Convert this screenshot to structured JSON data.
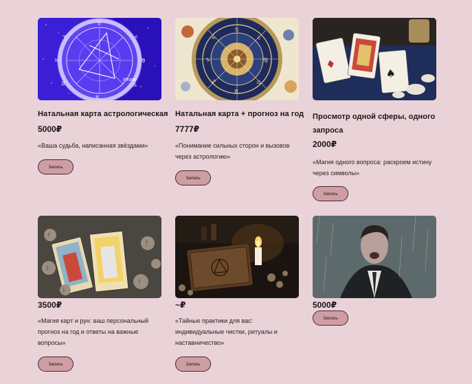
{
  "products": [
    {
      "title": "Натальная карта астрологическая",
      "price": "5000₽",
      "description": "«Ваша судьба, написанная звёздами»",
      "button": "Запись",
      "image_overlay_text": "Итоги"
    },
    {
      "title": "Натальная карта + прогноз на год",
      "price": "7777₽",
      "description": "«Понимание сильных сторон и вызовов через астрологию»",
      "button": "Запись"
    },
    {
      "title": "Просмотр одной сферы, одного запроса",
      "price": "2000₽",
      "description": "«Магия одного вопроса: раскроем истину через символы»",
      "button": "Запись"
    },
    {
      "title": "",
      "price": "3500₽",
      "description": "«Магия карт и рун: ваш персональный прогноз на год и ответы на важные вопросы»",
      "button": "Запись"
    },
    {
      "title": "",
      "price": "~₽",
      "description": "«Тайные практики для вас: индивидуальные чистки, ритуалы и наставничество»",
      "button": "Запись"
    },
    {
      "title": "",
      "price": "5000₽",
      "description": "",
      "button": "Запись"
    }
  ]
}
